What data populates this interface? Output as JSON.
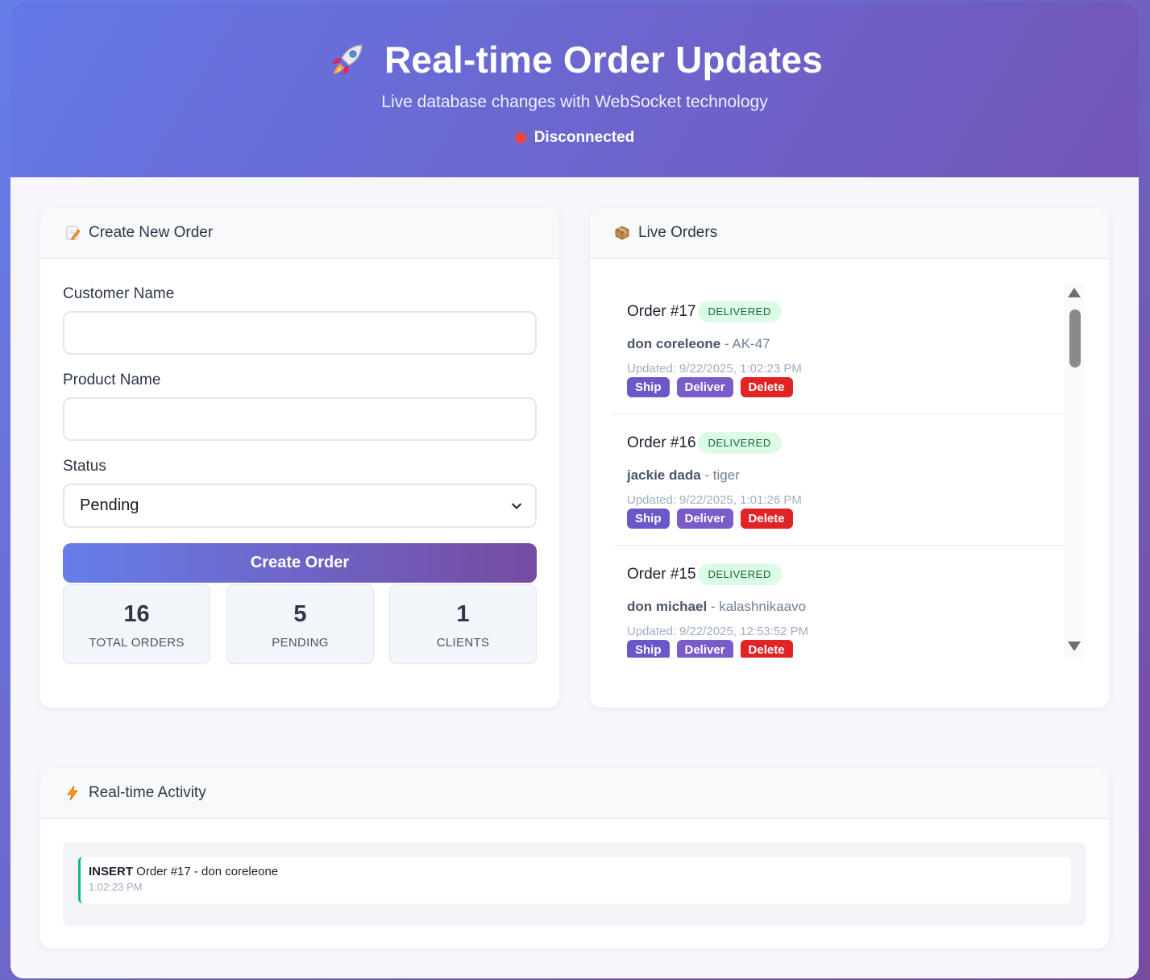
{
  "header": {
    "title": "Real-time Order Updates",
    "subtitle": "Live database changes with WebSocket technology",
    "connection_status": "Disconnected",
    "status_color": "#ef4444",
    "title_icon": "rocket-icon"
  },
  "create": {
    "title": "Create New Order",
    "icon": "memo-icon",
    "customer_label": "Customer Name",
    "customer_value": "",
    "product_label": "Product Name",
    "product_value": "",
    "status_label": "Status",
    "status_value": "Pending",
    "submit_label": "Create Order"
  },
  "stats": [
    {
      "value": "16",
      "label": "TOTAL ORDERS"
    },
    {
      "value": "5",
      "label": "PENDING"
    },
    {
      "value": "1",
      "label": "CLIENTS"
    }
  ],
  "orders": {
    "title": "Live Orders",
    "icon": "package-icon",
    "items": [
      {
        "title": "Order #17",
        "status": "DELIVERED",
        "customer": "don coreleone",
        "product": " - AK-47",
        "updated": "Updated: 9/22/2025, 1:02:23 PM",
        "ship": "Ship",
        "deliver": "Deliver",
        "delete": "Delete"
      },
      {
        "title": "Order #16",
        "status": "DELIVERED",
        "customer": "jackie dada",
        "product": " - tiger",
        "updated": "Updated: 9/22/2025, 1:01:26 PM",
        "ship": "Ship",
        "deliver": "Deliver",
        "delete": "Delete"
      },
      {
        "title": "Order #15",
        "status": "DELIVERED",
        "customer": "don michael",
        "product": " - kalashnikaavo",
        "updated": "Updated: 9/22/2025, 12:53:52 PM",
        "ship": "Ship",
        "deliver": "Deliver",
        "delete": "Delete"
      }
    ]
  },
  "activity": {
    "title": "Real-time Activity",
    "icon": "lightning-icon",
    "items": [
      {
        "op": "INSERT",
        "text": " Order #17 - don coreleone",
        "time": "1:02:23 PM"
      }
    ]
  }
}
